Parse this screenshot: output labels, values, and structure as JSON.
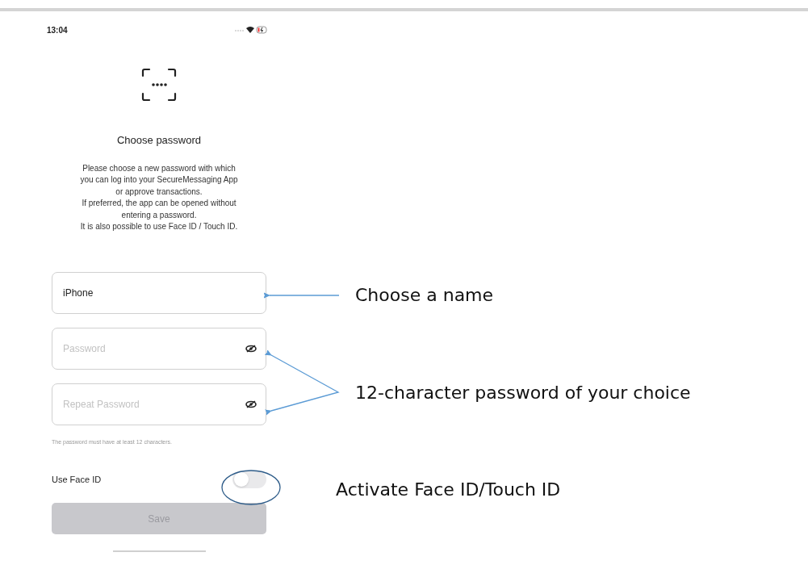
{
  "status_bar": {
    "time": "13:04"
  },
  "screen": {
    "title": "Choose password",
    "description": [
      "Please choose a new password with which",
      "you can log into your SecureMessaging App",
      "or approve transactions.",
      "If preferred, the app can be opened without",
      "entering a password.",
      "It is also possible to use Face ID / Touch ID."
    ],
    "fields": [
      {
        "kind": "text",
        "value": "iPhone"
      },
      {
        "kind": "secret",
        "placeholder": "Password"
      },
      {
        "kind": "secret",
        "placeholder": "Repeat Password"
      }
    ],
    "hint": "The password must have at least 12 characters.",
    "face_id": {
      "label": "Use Face ID",
      "on": false
    },
    "save": {
      "label": "Save",
      "disabled": true
    }
  },
  "annotations": [
    "Choose a name",
    "12-character password of your choice",
    "Activate Face ID/Touch ID"
  ]
}
